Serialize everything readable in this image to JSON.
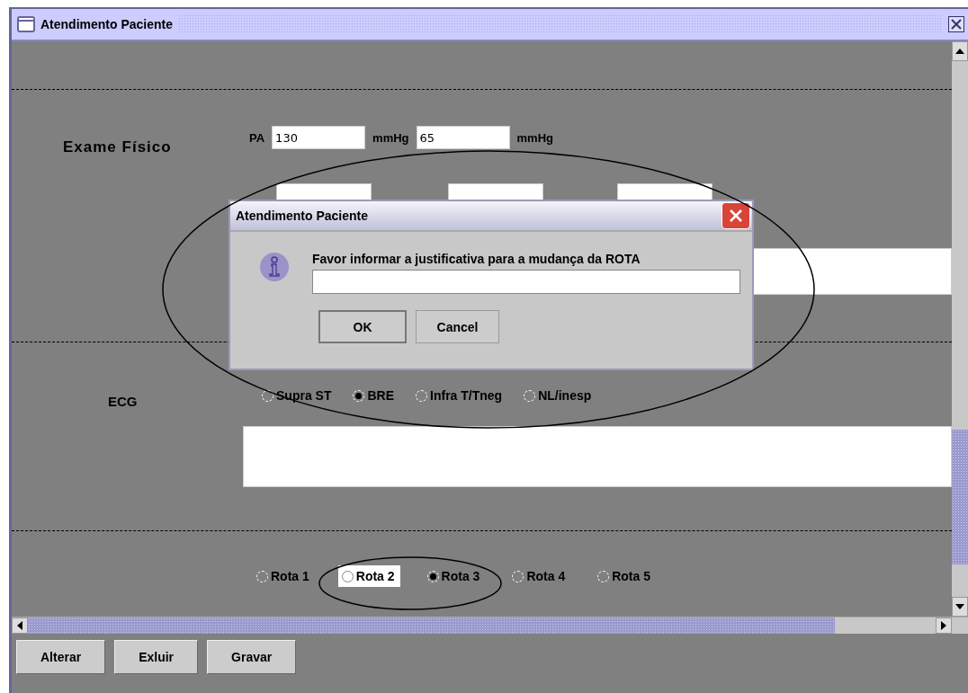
{
  "window": {
    "title": "Atendimento Paciente"
  },
  "exam": {
    "label": "Exame Físico",
    "pa_label": "PA",
    "systolic": "130",
    "unit_1": "mmHg",
    "diastolic": "65",
    "unit_2": "mmHg"
  },
  "ecg": {
    "label": "ECG",
    "options": [
      {
        "label": "Supra ST",
        "selected": false
      },
      {
        "label": "BRE",
        "selected": true
      },
      {
        "label": "Infra T/Tneg",
        "selected": false
      },
      {
        "label": "NL/inesp",
        "selected": false
      }
    ]
  },
  "routes": [
    {
      "label": "Rota 1",
      "selected": false,
      "focused": false
    },
    {
      "label": "Rota 2",
      "selected": false,
      "focused": true
    },
    {
      "label": "Rota 3",
      "selected": true,
      "focused": false
    },
    {
      "label": "Rota 4",
      "selected": false,
      "focused": false
    },
    {
      "label": "Rota 5",
      "selected": false,
      "focused": false
    }
  ],
  "buttons": [
    "Alterar",
    "Exluir",
    "Gravar"
  ],
  "dialog": {
    "title": "Atendimento Paciente",
    "message": "Favor informar a justificativa para a mudança da ROTA",
    "buttons": [
      "OK",
      "Cancel"
    ]
  }
}
